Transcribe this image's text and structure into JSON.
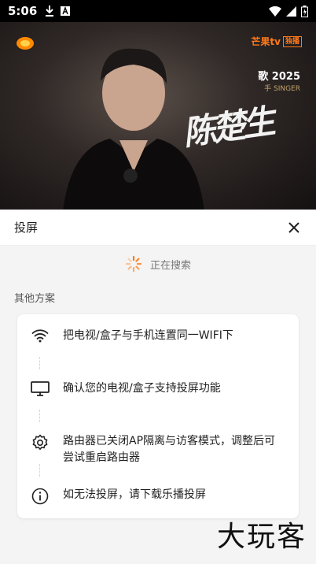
{
  "status_bar": {
    "time": "5:06"
  },
  "video": {
    "channel_logo": "芒果tv",
    "channel_badge": "独播",
    "show_title_line1": "歌 2025",
    "show_title_line2": "手 SINGER",
    "name_text": "陈楚生"
  },
  "sheet": {
    "title": "投屏",
    "searching_text": "正在搜索",
    "section_title": "其他方案",
    "steps": [
      {
        "icon": "wifi-icon",
        "text": "把电视/盒子与手机连置同一WIFI下"
      },
      {
        "icon": "monitor-icon",
        "text": "确认您的电视/盒子支持投屏功能"
      },
      {
        "icon": "gear-icon",
        "text": "路由器已关闭AP隔离与访客模式，调整后可尝试重启路由器"
      },
      {
        "icon": "info-icon",
        "text": "如无法投屏，请下载乐播投屏"
      }
    ]
  },
  "watermark": "大玩客",
  "colors": {
    "accent": "#ff7a1a",
    "sheet_bg": "#f4f4f4"
  }
}
